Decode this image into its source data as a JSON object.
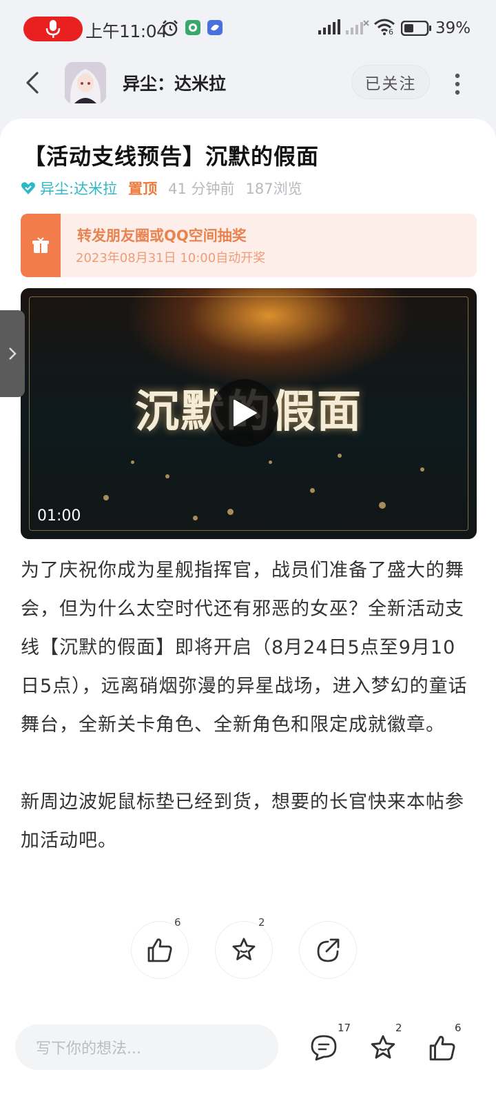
{
  "status_bar": {
    "time": "上午11:04",
    "battery": "39%",
    "signal_badge": "6"
  },
  "header": {
    "channel_name": "异尘：达米拉",
    "follow_label": "已关注"
  },
  "post": {
    "title": "【活动支线预告】沉默的假面",
    "author": "异尘:达米拉",
    "pin_label": "置顶",
    "time_ago": "41 分钟前",
    "views": "187浏览",
    "lottery": {
      "title": "转发朋友圈或QQ空间抽奖",
      "subtitle": "2023年08月31日 10:00自动开奖"
    },
    "video": {
      "title_text": "沉默的假面",
      "duration": "01:00"
    },
    "paragraphs": [
      "为了庆祝你成为星舰指挥官，战员们准备了盛大的舞会，但为什么太空时代还有邪恶的女巫？全新活动支线【沉默的假面】即将开启（8月24日5点至9月10日5点），远离硝烟弥漫的异星战场，进入梦幻的童话舞台，全新关卡角色、全新角色和限定成就徽章。",
      "新周边波妮鼠标垫已经到货，想要的长官快来本帖参加活动吧。"
    ],
    "actions": {
      "like_count": "6",
      "favorite_count": "2"
    }
  },
  "bottom_bar": {
    "comment_placeholder": "写下你的想法...",
    "comment_count": "17",
    "favorite_count": "2",
    "like_count": "6"
  },
  "colors": {
    "accent_teal": "#2eb7c7",
    "pin_orange": "#ef7a3c",
    "lottery_orange": "#f37c4b",
    "mic_red": "#e8201f"
  }
}
